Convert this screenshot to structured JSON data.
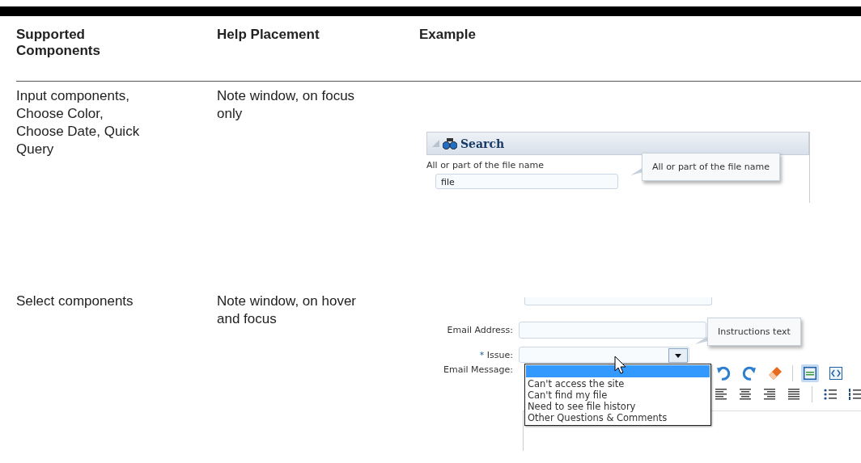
{
  "table": {
    "columns": [
      "Supported Components",
      "Help Placement",
      "Example"
    ],
    "rows": [
      {
        "components": "Input components, Choose Color, Choose Date, Quick Query",
        "placement": "Note window, on focus only",
        "example": {
          "kind": "search_panel",
          "panel_title": "Search",
          "field_label": "All or part of the file name",
          "field_value": "file",
          "note": "All or part of the file name"
        }
      },
      {
        "components": "Select components",
        "placement": "Note window, on hover and focus",
        "example": {
          "kind": "email_form",
          "email_label": "Email Address:",
          "required_mark": "*",
          "issue_label": "Issue:",
          "message_label": "Email Message:",
          "note": "Instructions text",
          "options": [
            {
              "label": "Can't access the site",
              "selected": false
            },
            {
              "label": "Can't find my file",
              "selected": false
            },
            {
              "label": "Need to see file history",
              "selected": false
            },
            {
              "label": "Other Questions & Comments",
              "selected": false
            }
          ]
        }
      }
    ]
  }
}
